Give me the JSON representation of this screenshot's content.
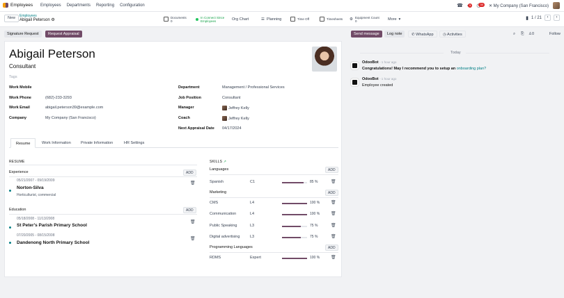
{
  "nav": {
    "app_name": "Employees",
    "menu": [
      "Employees",
      "Departments",
      "Reporting",
      "Configuration"
    ],
    "badge_messages": "5",
    "badge_activities": "30",
    "company": "My Company (San Francisco)"
  },
  "control": {
    "new_label": "New",
    "breadcrumb_parent": "Employees",
    "breadcrumb_current": "Abigail Peterson",
    "smart_buttons": [
      {
        "label": "Documents",
        "value": "0"
      },
      {
        "label": "In Connect Since",
        "value": "Employees"
      },
      {
        "label": "Org Chart",
        "value": ""
      },
      {
        "label": "Planning",
        "value": ""
      },
      {
        "label": "Time Off",
        "value": ""
      },
      {
        "label": "Timesheets",
        "value": ""
      },
      {
        "label": "Equipment Count",
        "value": "0"
      },
      {
        "label": "More",
        "value": ""
      }
    ],
    "pager": "1 / 21"
  },
  "status": {
    "signature_request": "Signature Request",
    "request_appraisal": "Request Appraisal"
  },
  "employee": {
    "name": "Abigail Peterson",
    "job_title": "Consultant",
    "tags_placeholder": "Tags",
    "left_fields": [
      {
        "label": "Work Mobile",
        "value": ""
      },
      {
        "label": "Work Phone",
        "value": "(682)-233-3293"
      },
      {
        "label": "Work Email",
        "value": "abigail.peterson39@example.com"
      },
      {
        "label": "Company",
        "value": "My Company (San Francisco)"
      }
    ],
    "right_fields": [
      {
        "label": "Department",
        "value": "Management / Professional Services"
      },
      {
        "label": "Job Position",
        "value": "Consultant"
      },
      {
        "label": "Manager",
        "value": "Jeffrey Kelly"
      },
      {
        "label": "Coach",
        "value": "Jeffrey Kelly"
      },
      {
        "label": "Next Appraisal Date",
        "value": "04/17/2024"
      }
    ]
  },
  "tabs": [
    "Resume",
    "Work Information",
    "Private Information",
    "HR Settings"
  ],
  "resume": {
    "heading": "RESUME",
    "add_label": "ADD",
    "experience_title": "Experience",
    "education_title": "Education",
    "experience": [
      {
        "dates": "05/21/2007 - 09/19/2009",
        "title": "Norton-Silva",
        "sub": "Horticulturist, commercial"
      }
    ],
    "education": [
      {
        "dates": "05/18/2008 - 11/13/2008",
        "title": "St Peter's Parish Primary School",
        "sub": ""
      },
      {
        "dates": "07/20/2005 - 08/15/2008",
        "title": "Dandenong North Primary School",
        "sub": ""
      }
    ]
  },
  "skills": {
    "heading": "SKILLS",
    "add_label": "ADD",
    "groups": [
      {
        "name": "Languages",
        "items": [
          {
            "skill": "Spanish",
            "level": "C1",
            "progress": 85,
            "pct": "85 %"
          }
        ]
      },
      {
        "name": "Marketing",
        "items": [
          {
            "skill": "CMS",
            "level": "L4",
            "progress": 100,
            "pct": "100 %"
          },
          {
            "skill": "Communication",
            "level": "L4",
            "progress": 100,
            "pct": "100 %"
          },
          {
            "skill": "Public Speaking",
            "level": "L3",
            "progress": 75,
            "pct": "75 %"
          },
          {
            "skill": "Digital advertising",
            "level": "L3",
            "progress": 75,
            "pct": "75 %"
          }
        ]
      },
      {
        "name": "Programming Languages",
        "items": [
          {
            "skill": "RDMS",
            "level": "Expert",
            "progress": 100,
            "pct": "100 %"
          }
        ]
      }
    ]
  },
  "chatter": {
    "send_message": "Send message",
    "log_note": "Log note",
    "whatsapp": "WhatsApp",
    "activities": "Activities",
    "followers": "0",
    "follow": "Follow",
    "today": "Today",
    "messages": [
      {
        "author": "OdooBot",
        "time": "- 1 hour ago",
        "text": "Congratulations! May I recommend you to setup an ",
        "link": "onboarding plan?"
      },
      {
        "author": "OdooBot",
        "time": "- 1 hour ago",
        "text": "Employee created",
        "link": ""
      }
    ]
  },
  "colors": {
    "primary": "#714b67",
    "link": "#017e84"
  }
}
